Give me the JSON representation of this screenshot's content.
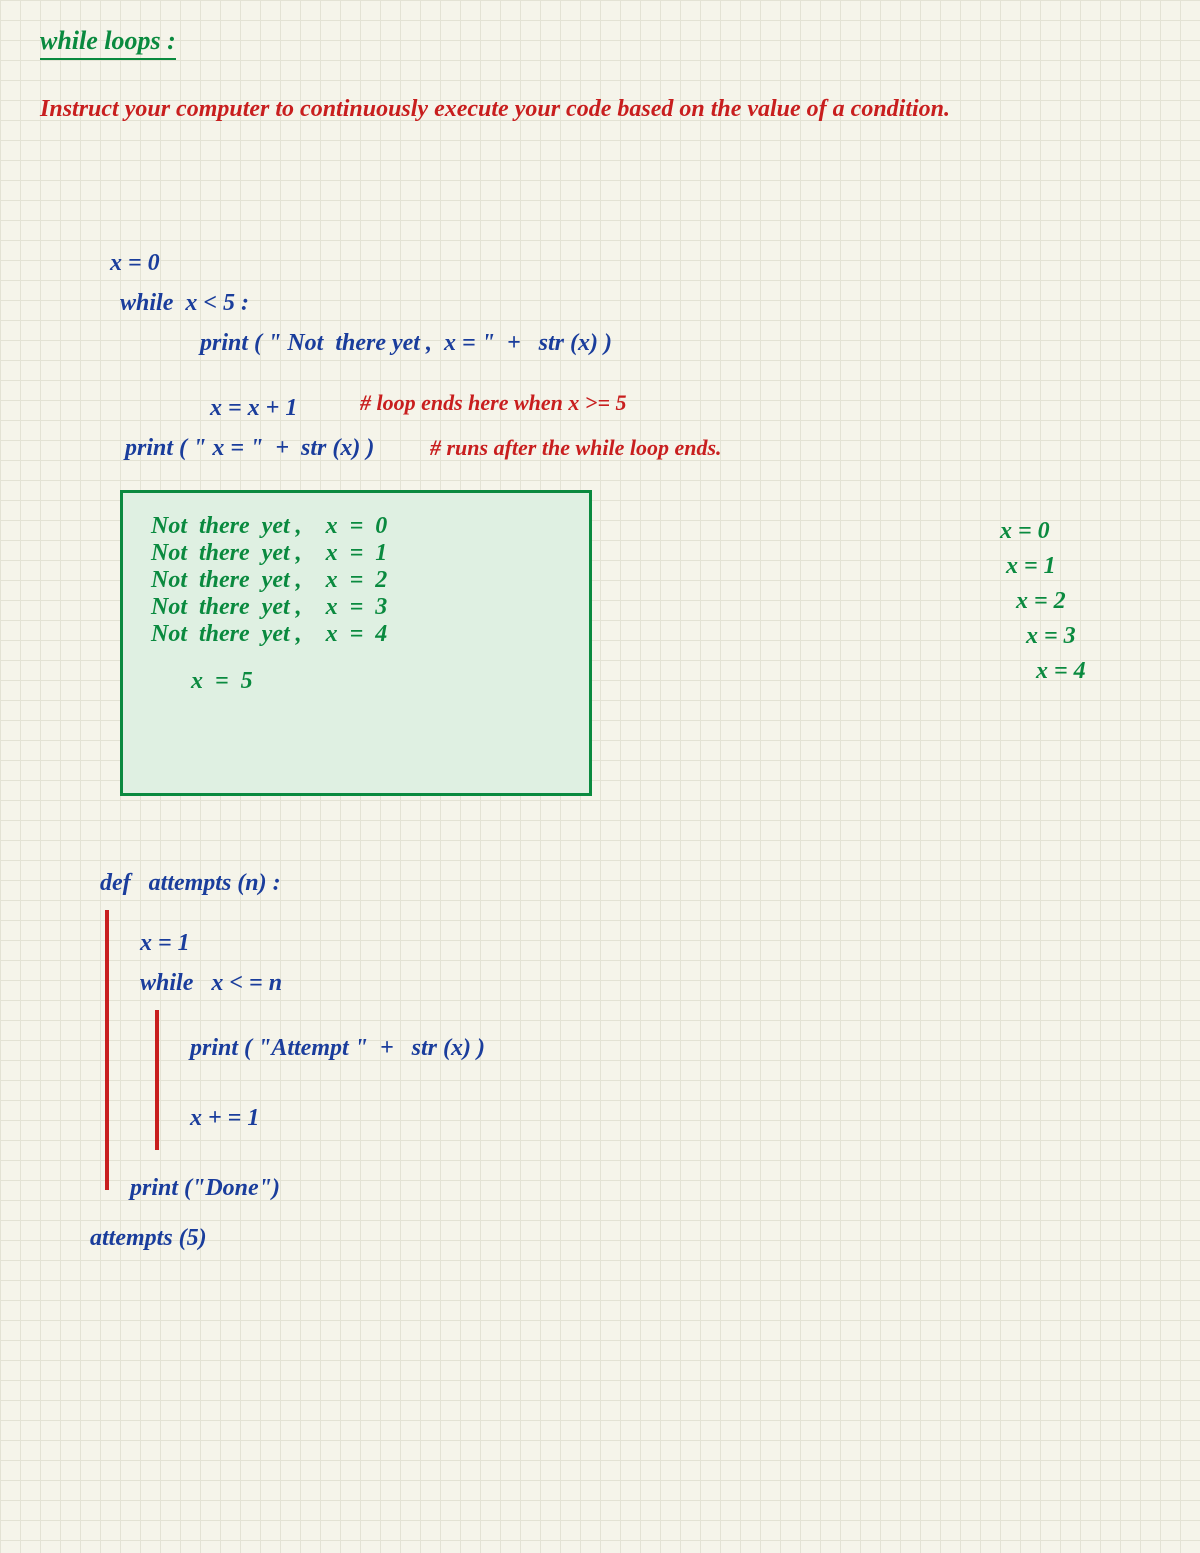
{
  "title": "while loops :",
  "description": "Instruct your computer to continuously execute your code based on the value of a condition.",
  "code1": {
    "l1": "x = 0",
    "l2": "while  x < 5 :",
    "l3": "print ( \" Not  there yet ,  x = \"  +   str (x) )",
    "l4": "x = x + 1",
    "c1": "# loop ends here when x >= 5",
    "l5": "print ( \" x = \"  +  str (x) )",
    "c2": "# runs after the while loop ends."
  },
  "output": {
    "l1": "Not  there  yet ,    x  =  0",
    "l2": "Not  there  yet ,    x  =  1",
    "l3": "Not  there  yet ,    x  =  2",
    "l4": "Not  there  yet ,    x  =  3",
    "l5": "Not  there  yet ,    x  =  4",
    "l6": "x  =  5"
  },
  "side": {
    "s1": "x = 0",
    "s2": "x = 1",
    "s3": "x = 2",
    "s4": "x = 3",
    "s5": "x = 4"
  },
  "code2": {
    "l1": "def   attempts (n) :",
    "l2": "x = 1",
    "l3": "while   x < = n",
    "l4": "print ( \"Attempt \"  +   str (x) )",
    "l5": "x + = 1",
    "l6": "print (\"Done\")",
    "l7": "attempts (5)"
  }
}
